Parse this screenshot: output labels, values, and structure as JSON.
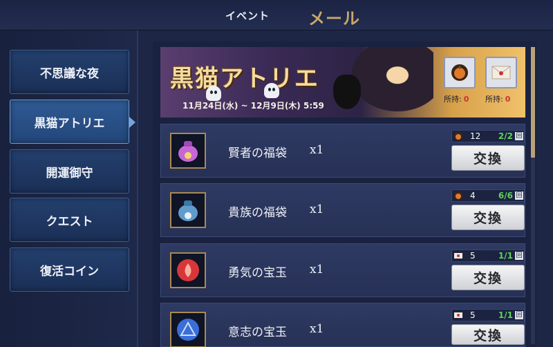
{
  "header": {
    "tab_event": "イベント",
    "tab_mail": "メール"
  },
  "sidebar": {
    "items": [
      {
        "label": "不思議な夜",
        "active": false
      },
      {
        "label": "黒猫アトリエ",
        "active": true
      },
      {
        "label": "開運御守",
        "active": false
      },
      {
        "label": "クエスト",
        "active": false
      },
      {
        "label": "復活コイン",
        "active": false
      }
    ]
  },
  "banner": {
    "title": "黒猫アトリエ",
    "date_range": "11月24日(水) ~ 12月9日(木) 5:59",
    "currencies": [
      {
        "icon": "pumpkin-coin-icon",
        "owned_label": "所持:",
        "owned_value": "0"
      },
      {
        "icon": "letter-envelope-icon",
        "owned_label": "所持:",
        "owned_value": "0"
      }
    ]
  },
  "items": [
    {
      "name": "賢者の福袋",
      "qty": "x1",
      "icon": "purple-lucky-bag-icon",
      "cost_icon": "pumpkin-coin-icon",
      "cost": "12",
      "limit": "2/2",
      "unit": "回",
      "button": "交換",
      "icon_color": "#c667d8"
    },
    {
      "name": "貴族の福袋",
      "qty": "x1",
      "icon": "blue-lucky-bag-icon",
      "cost_icon": "pumpkin-coin-icon",
      "cost": "4",
      "limit": "6/6",
      "unit": "回",
      "button": "交換",
      "icon_color": "#5f9ccc"
    },
    {
      "name": "勇気の宝玉",
      "qty": "x1",
      "icon": "red-fire-orb-icon",
      "cost_icon": "letter-envelope-icon",
      "cost": "5",
      "limit": "1/1",
      "unit": "回",
      "button": "交換",
      "icon_color": "#d9363a"
    },
    {
      "name": "意志の宝玉",
      "qty": "x1",
      "icon": "blue-triangle-orb-icon",
      "cost_icon": "letter-envelope-icon",
      "cost": "5",
      "limit": "1/1",
      "unit": "回",
      "button": "交換",
      "icon_color": "#3a6ed8"
    }
  ],
  "colors": {
    "accent_gold": "#c9a76a",
    "limit_green": "#5fd25a",
    "owned_red": "#c9372c"
  }
}
